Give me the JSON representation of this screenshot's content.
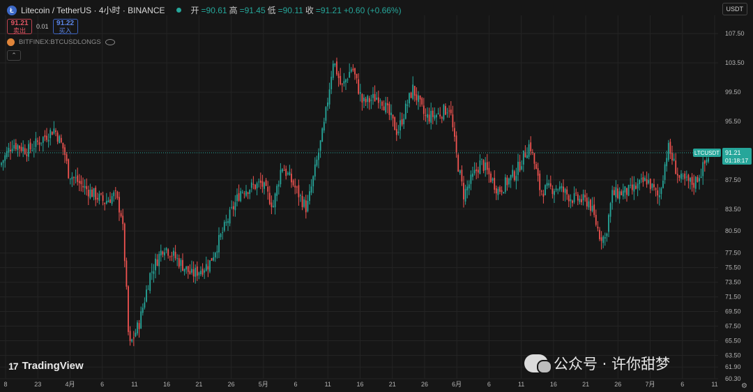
{
  "header": {
    "symbol_title": "Litecoin / TetherUS · 4小时 · BINANCE",
    "coin_glyph": "Ł",
    "ohlc": [
      {
        "label": "开",
        "value": "90.61"
      },
      {
        "label": "高",
        "value": "91.45"
      },
      {
        "label": "低",
        "value": "90.11"
      },
      {
        "label": "收",
        "value": "91.21"
      },
      {
        "label": "",
        "value": "+0.60 (+0.66%)"
      }
    ]
  },
  "trade": {
    "sell_price": "91.21",
    "sell_label": "卖出",
    "spread": "0.01",
    "buy_price": "91.22",
    "buy_label": "买入"
  },
  "indicator": {
    "name": "BITFINEX:BTCUSDLONGS"
  },
  "currency_button": "USDT",
  "branding": "TradingView",
  "watermark": "公众号 · 许你甜梦",
  "colors": {
    "up": "#26a69a",
    "down": "#ef5350",
    "bg": "#161616",
    "grid": "#242424"
  },
  "chart_data": {
    "type": "candlestick",
    "symbol": "LTCUSDT",
    "last_price": "91.21",
    "countdown": "01:18:17",
    "ylim": [
      60.3,
      110.0
    ],
    "y_ticks": [
      "107.50",
      "103.50",
      "99.50",
      "95.50",
      "91.50",
      "87.50",
      "83.50",
      "80.50",
      "77.50",
      "75.50",
      "73.50",
      "71.50",
      "69.50",
      "67.50",
      "65.50",
      "63.50",
      "61.90",
      "60.30"
    ],
    "x_ticks": [
      "8",
      "23",
      "4月",
      "6",
      "11",
      "16",
      "21",
      "26",
      "5月",
      "6",
      "11",
      "16",
      "21",
      "26",
      "6月",
      "6",
      "11",
      "16",
      "21",
      "26",
      "7月",
      "6",
      "11"
    ],
    "price_path": [
      [
        0,
        89.5
      ],
      [
        18,
        92.5
      ],
      [
        40,
        91.5
      ],
      [
        78,
        94.5
      ],
      [
        92,
        91.5
      ],
      [
        98,
        88.5
      ],
      [
        120,
        86.5
      ],
      [
        150,
        84.5
      ],
      [
        165,
        85.5
      ],
      [
        175,
        82.5
      ],
      [
        180,
        75.0
      ],
      [
        185,
        64.5
      ],
      [
        200,
        68.0
      ],
      [
        215,
        74.5
      ],
      [
        235,
        78.5
      ],
      [
        260,
        76.0
      ],
      [
        275,
        74.5
      ],
      [
        300,
        76.0
      ],
      [
        320,
        80.5
      ],
      [
        345,
        86.0
      ],
      [
        375,
        87.0
      ],
      [
        392,
        84.0
      ],
      [
        404,
        89.5
      ],
      [
        420,
        87.0
      ],
      [
        440,
        83.5
      ],
      [
        450,
        88.0
      ],
      [
        465,
        95.0
      ],
      [
        478,
        104.0
      ],
      [
        490,
        100.0
      ],
      [
        505,
        103.0
      ],
      [
        520,
        98.0
      ],
      [
        545,
        99.0
      ],
      [
        570,
        94.0
      ],
      [
        592,
        100.0
      ],
      [
        610,
        96.0
      ],
      [
        630,
        96.5
      ],
      [
        645,
        97.5
      ],
      [
        655,
        90.5
      ],
      [
        665,
        85.5
      ],
      [
        690,
        90.0
      ],
      [
        715,
        86.0
      ],
      [
        740,
        88.5
      ],
      [
        760,
        92.5
      ],
      [
        775,
        86.0
      ],
      [
        800,
        86.5
      ],
      [
        820,
        85.0
      ],
      [
        845,
        84.5
      ],
      [
        860,
        80.0
      ],
      [
        868,
        79.5
      ],
      [
        878,
        85.5
      ],
      [
        905,
        86.0
      ],
      [
        928,
        87.5
      ],
      [
        945,
        85.0
      ],
      [
        958,
        92.0
      ],
      [
        975,
        87.5
      ],
      [
        995,
        87.0
      ],
      [
        1005,
        88.5
      ],
      [
        1018,
        91.2
      ]
    ]
  }
}
